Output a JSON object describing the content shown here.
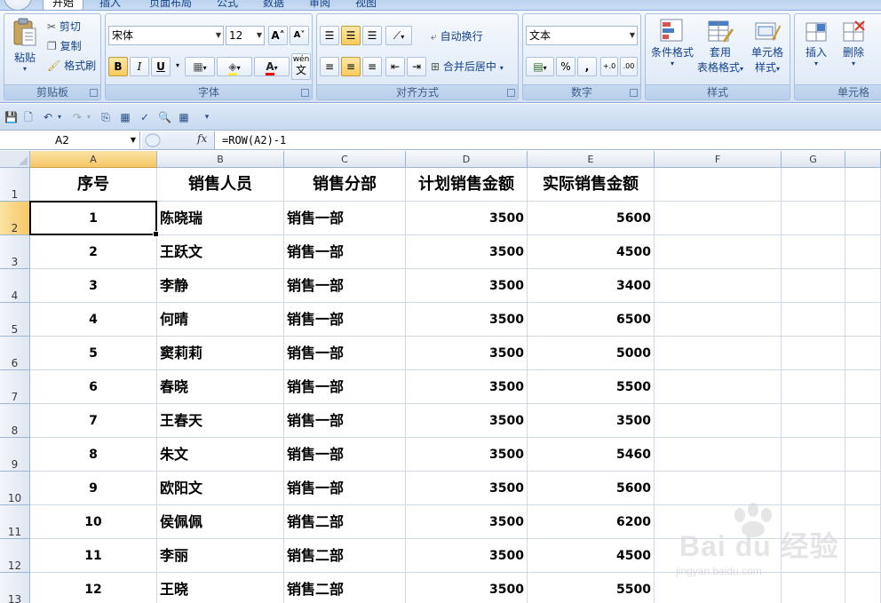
{
  "ribbon_tabs": [
    "开始",
    "插入",
    "页面布局",
    "公式",
    "数据",
    "审阅",
    "视图"
  ],
  "clipboard": {
    "paste": "粘贴",
    "cut": "剪切",
    "copy": "复制",
    "format_painter": "格式刷",
    "label": "剪贴板"
  },
  "font": {
    "name": "宋体",
    "size": "12",
    "label": "字体",
    "bold": "B",
    "italic": "I",
    "underline": "U",
    "font_color_glyph": "A",
    "wen": "wén",
    "wen_char": "文"
  },
  "alignment": {
    "wrap": "自动换行",
    "merge": "合并后居中",
    "label": "对齐方式"
  },
  "number": {
    "format": "文本",
    "percent": "%",
    "comma": ",",
    "label": "数字"
  },
  "styles": {
    "conditional": [
      "条件格式"
    ],
    "table": [
      "套用",
      "表格格式"
    ],
    "cell": [
      "单元格",
      "样式"
    ],
    "label": "样式"
  },
  "cells": {
    "insert": "插入",
    "delete": "删除",
    "label": "单元格"
  },
  "name_box": "A2",
  "fx": "fx",
  "formula": "=ROW(A2)-1",
  "columns": [
    "A",
    "B",
    "C",
    "D",
    "E",
    "F",
    "G"
  ],
  "header_row": {
    "row": "1",
    "cells": [
      "序号",
      "销售人员",
      "销售分部",
      "计划销售金额",
      "实际销售金额"
    ]
  },
  "rows": [
    {
      "row": "2",
      "cells": [
        "1",
        "陈晓瑞",
        "销售一部",
        "3500",
        "5600"
      ]
    },
    {
      "row": "3",
      "cells": [
        "2",
        "王跃文",
        "销售一部",
        "3500",
        "4500"
      ]
    },
    {
      "row": "4",
      "cells": [
        "3",
        "李静",
        "销售一部",
        "3500",
        "3400"
      ]
    },
    {
      "row": "5",
      "cells": [
        "4",
        "何晴",
        "销售一部",
        "3500",
        "6500"
      ]
    },
    {
      "row": "6",
      "cells": [
        "5",
        "窦莉莉",
        "销售一部",
        "3500",
        "5000"
      ]
    },
    {
      "row": "7",
      "cells": [
        "6",
        "春晓",
        "销售一部",
        "3500",
        "5500"
      ]
    },
    {
      "row": "8",
      "cells": [
        "7",
        "王春天",
        "销售一部",
        "3500",
        "3500"
      ]
    },
    {
      "row": "9",
      "cells": [
        "8",
        "朱文",
        "销售一部",
        "3500",
        "5460"
      ]
    },
    {
      "row": "10",
      "cells": [
        "9",
        "欧阳文",
        "销售一部",
        "3500",
        "5600"
      ]
    },
    {
      "row": "11",
      "cells": [
        "10",
        "侯佩佩",
        "销售二部",
        "3500",
        "6200"
      ]
    },
    {
      "row": "12",
      "cells": [
        "11",
        "李丽",
        "销售二部",
        "3500",
        "4500"
      ]
    },
    {
      "row": "13",
      "cells": [
        "12",
        "王晓",
        "销售二部",
        "3500",
        "5500"
      ]
    }
  ],
  "watermark": {
    "brand": "Bai du 经验",
    "url": "jingyan.baidu.com"
  },
  "colors": {
    "ribbon": "#dfe9f7",
    "selected_header": "#f6c765",
    "grid_line": "#d0d7e5"
  }
}
